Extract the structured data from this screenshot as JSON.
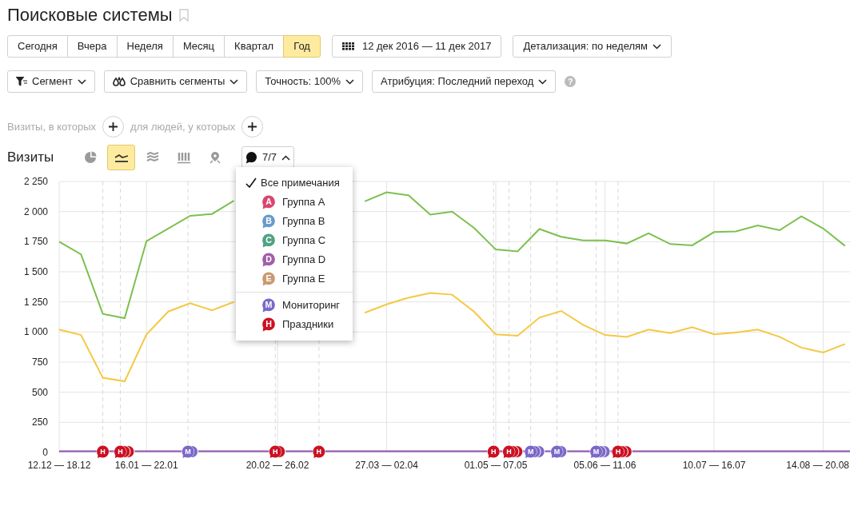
{
  "title": "Поисковые системы",
  "periods": [
    {
      "label": "Сегодня",
      "selected": false
    },
    {
      "label": "Вчера",
      "selected": false
    },
    {
      "label": "Неделя",
      "selected": false
    },
    {
      "label": "Месяц",
      "selected": false
    },
    {
      "label": "Квартал",
      "selected": false
    },
    {
      "label": "Год",
      "selected": true
    }
  ],
  "date_range": "12 дек 2016 — 11 дек 2017",
  "detail": "Детализация: по неделям",
  "filters": [
    {
      "kind": "segment",
      "label": "Сегмент"
    },
    {
      "kind": "compare",
      "label": "Сравнить сегменты"
    },
    {
      "kind": "plain",
      "label": "Точность: 100%"
    },
    {
      "kind": "plain",
      "label": "Атрибуция: Последний переход"
    }
  ],
  "help": "?",
  "conditions": {
    "visits_label": "Визиты, в которых",
    "people_label": "для людей, у которых"
  },
  "report": {
    "title": "Визиты",
    "views": [
      {
        "kind": "pie",
        "selected": false
      },
      {
        "kind": "line",
        "selected": true
      },
      {
        "kind": "area",
        "selected": false
      },
      {
        "kind": "bars",
        "selected": false
      },
      {
        "kind": "map",
        "selected": false
      }
    ],
    "notes_count": "7/7",
    "notes_expanded": true,
    "notes_menu": [
      {
        "kind": "all",
        "label": "Все примечания",
        "checked": true
      },
      {
        "kind": "group",
        "letter": "A",
        "label": "Группа A",
        "color": "#d9466f"
      },
      {
        "kind": "group",
        "letter": "B",
        "label": "Группа B",
        "color": "#6a9bc9"
      },
      {
        "kind": "group",
        "letter": "C",
        "label": "Группа C",
        "color": "#4fa282"
      },
      {
        "kind": "group",
        "letter": "D",
        "label": "Группа D",
        "color": "#a05fa8"
      },
      {
        "kind": "group",
        "letter": "E",
        "label": "Группа E",
        "color": "#c99a70"
      },
      {
        "kind": "divider"
      },
      {
        "kind": "group",
        "letter": "M",
        "label": "Мониторинг",
        "color": "#7b68c8"
      },
      {
        "kind": "group",
        "letter": "H",
        "label": "Праздники",
        "color": "#cc1122"
      }
    ],
    "note_markers": [
      {
        "kind": "single",
        "letter": "H",
        "color": "#cc1122"
      },
      {
        "kind": "triple",
        "letter": "H",
        "color": "#cc1122"
      },
      {
        "kind": "double",
        "letter": "M",
        "color": "#7b68c8"
      },
      {
        "kind": "double",
        "letter": "H",
        "color": "#cc1122"
      },
      {
        "kind": "single",
        "letter": "H",
        "color": "#cc1122"
      },
      {
        "kind": "single",
        "letter": "H",
        "color": "#cc1122"
      },
      {
        "kind": "triple",
        "letter": "H",
        "color": "#cc1122"
      },
      {
        "kind": "triple",
        "letter": "M",
        "color": "#7b68c8"
      },
      {
        "kind": "double",
        "letter": "M",
        "color": "#7b68c8"
      },
      {
        "kind": "triple",
        "letter": "M",
        "color": "#7b68c8"
      },
      {
        "kind": "triple",
        "letter": "H",
        "color": "#cc1122"
      }
    ],
    "chart_data": {
      "type": "line",
      "grid": true,
      "categories": [
        "12.12 — 18.12",
        null,
        null,
        null,
        "16.01 — 22.01",
        null,
        null,
        null,
        null,
        null,
        "20.02 — 26.02",
        null,
        null,
        null,
        null,
        "27.03 — 02.04",
        null,
        null,
        null,
        null,
        "01.05 — 07.05",
        null,
        null,
        null,
        null,
        "05.06 — 11.06",
        null,
        null,
        null,
        null,
        "10.07 — 16.07",
        null,
        null,
        null,
        null,
        "14.08 — 20.08",
        null
      ],
      "ylim": [
        0,
        2250
      ],
      "yticks": [
        {
          "value": 0,
          "label": "0"
        },
        {
          "value": 250,
          "label": "250"
        },
        {
          "value": 500,
          "label": "500"
        },
        {
          "value": 750,
          "label": "750"
        },
        {
          "value": 1000,
          "label": "1 000"
        },
        {
          "value": 1250,
          "label": "1 250"
        },
        {
          "value": 1500,
          "label": "1 500"
        },
        {
          "value": 1750,
          "label": "1 750"
        },
        {
          "value": 2000,
          "label": "2 000"
        },
        {
          "value": 2250,
          "label": "2 250"
        }
      ],
      "series": [
        {
          "color": "#7cc04e",
          "values": [
            1750,
            1645,
            1150,
            1115,
            1755,
            1860,
            1965,
            1980,
            2090,
            null,
            null,
            null,
            null,
            null,
            2085,
            2160,
            2135,
            1975,
            2000,
            1865,
            1685,
            1670,
            1855,
            1790,
            1760,
            1760,
            1735,
            1820,
            1730,
            1720,
            1830,
            1835,
            1885,
            1845,
            1960,
            1860,
            1715
          ]
        },
        {
          "color": "#f5c842",
          "values": [
            1020,
            975,
            620,
            590,
            980,
            1170,
            1240,
            1180,
            1250,
            null,
            null,
            null,
            null,
            null,
            1160,
            1230,
            1285,
            1325,
            1310,
            1170,
            980,
            970,
            1120,
            1175,
            1060,
            975,
            960,
            1020,
            990,
            1040,
            980,
            995,
            1020,
            960,
            870,
            830,
            900
          ]
        }
      ]
    }
  }
}
